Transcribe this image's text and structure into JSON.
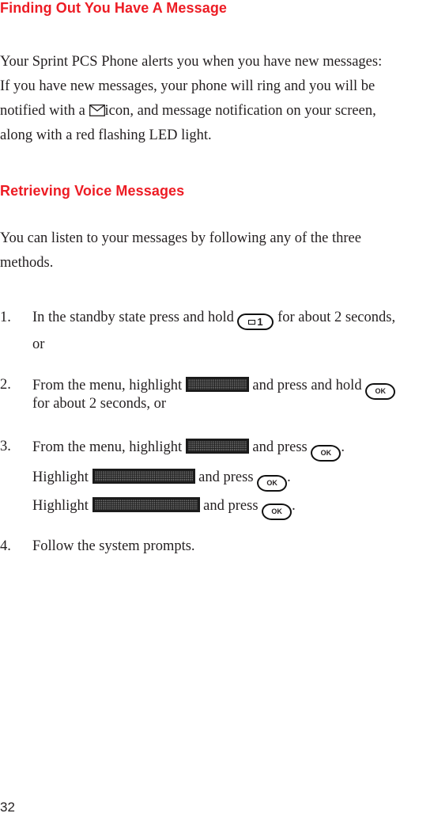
{
  "sections": {
    "finding": {
      "heading": "Finding Out You Have A Message",
      "lines": [
        "Your Sprint PCS Phone alerts you when you have new messages:",
        "If you have new messages, your phone will ring and you will be",
        "notified with a",
        "icon, and message notification on your screen,",
        "along with a red flashing LED light."
      ],
      "icon": "envelope-icon"
    },
    "retrieving": {
      "heading": "Retrieving Voice Messages",
      "intro_lines": [
        "You can listen to your messages by following any of the three",
        "methods."
      ]
    }
  },
  "steps": [
    {
      "number": "1.",
      "text_before": "In the standby state press and hold",
      "key": "1",
      "key_icon": "envelope-icon",
      "text_after": "for about 2 seconds,",
      "continuation": "or"
    },
    {
      "number": "2.",
      "text_before": "From the menu, highlight",
      "menu_item": "Messages",
      "text_middle": "and press and hold",
      "key": "OK",
      "continuation": "for about 2 seconds, or"
    },
    {
      "number": "3.",
      "rows": [
        {
          "text_before": "From the menu, highlight",
          "menu_item": "Messages",
          "text_after": "and press",
          "key": "OK",
          "end": "."
        },
        {
          "text_before": "Highlight",
          "menu_item": "Voicemail Box",
          "text_after": "and press",
          "key": "OK",
          "end": "."
        },
        {
          "text_before": "Highlight",
          "menu_item": "Call Voicemail",
          "text_after": "and press",
          "key": "OK",
          "end": "."
        }
      ]
    },
    {
      "number": "4.",
      "text": "Follow the system prompts."
    }
  ],
  "page_number": "32",
  "colors": {
    "heading": "#ed1c24",
    "body_text": "#231f20",
    "lcd_background": "#1b1b1b"
  }
}
